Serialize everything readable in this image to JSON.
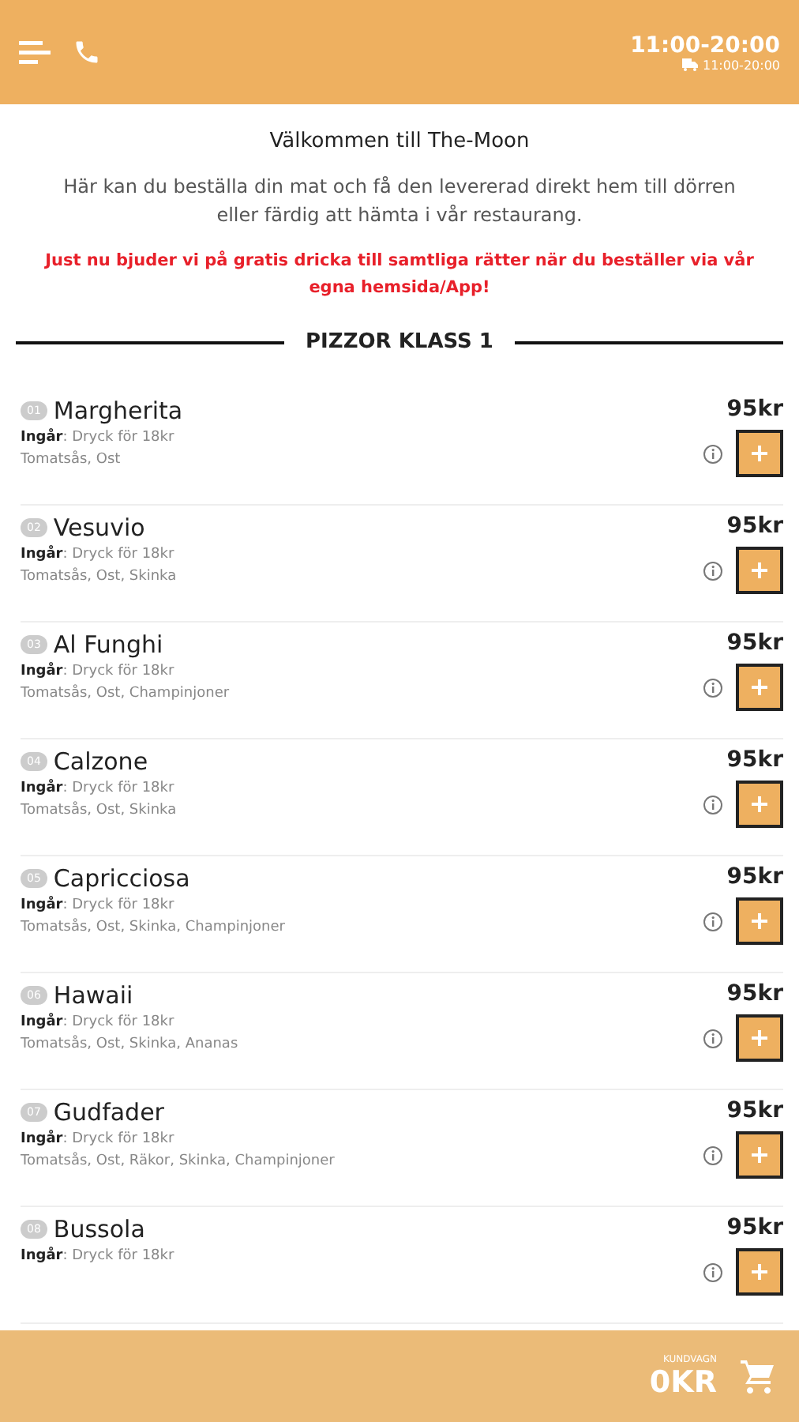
{
  "header": {
    "hours": "11:00-20:00",
    "delivery_hours": "11:00-20:00"
  },
  "intro": {
    "title": "Välkommen till The-Moon",
    "text": "Här kan du beställa din mat och få den levererad direkt hem till dörren eller färdig att hämta i vår restaurang.",
    "offer": "Just nu bjuder vi på gratis dricka till samtliga rätter när du beställer via vår egna hemsida/App!"
  },
  "category": "PIZZOR KLASS 1",
  "items": [
    {
      "number": "01",
      "name": "Margherita",
      "price": "95kr",
      "includes": "**Ingår**: Dryck för 18kr",
      "ingredients": "Tomatsås, Ost"
    },
    {
      "number": "02",
      "name": "Vesuvio",
      "price": "95kr",
      "includes": "**Ingår**: Dryck för 18kr",
      "ingredients": "Tomatsås, Ost, Skinka"
    },
    {
      "number": "03",
      "name": "Al Funghi",
      "price": "95kr",
      "includes": "**Ingår**: Dryck för 18kr",
      "ingredients": "Tomatsås, Ost, Champinjoner"
    },
    {
      "number": "04",
      "name": "Calzone",
      "price": "95kr",
      "includes": "**Ingår**: Dryck för 18kr",
      "ingredients": "Tomatsås, Ost, Skinka"
    },
    {
      "number": "05",
      "name": "Capricciosa",
      "price": "95kr",
      "includes": "**Ingår**: Dryck för 18kr",
      "ingredients": "Tomatsås, Ost, Skinka, Champinjoner"
    },
    {
      "number": "06",
      "name": "Hawaii",
      "price": "95kr",
      "includes": "**Ingår**: Dryck för 18kr",
      "ingredients": "Tomatsås, Ost, Skinka, Ananas"
    },
    {
      "number": "07",
      "name": "Gudfader",
      "price": "95kr",
      "includes": "**Ingår**: Dryck för 18kr",
      "ingredients": "Tomatsås, Ost, Räkor, Skinka, Champinjoner"
    },
    {
      "number": "08",
      "name": "Bussola",
      "price": "95kr",
      "includes": "**Ingår**: Dryck för 18kr"
    }
  ],
  "cart": {
    "label": "KUNDVAGN",
    "total": "0KR"
  }
}
